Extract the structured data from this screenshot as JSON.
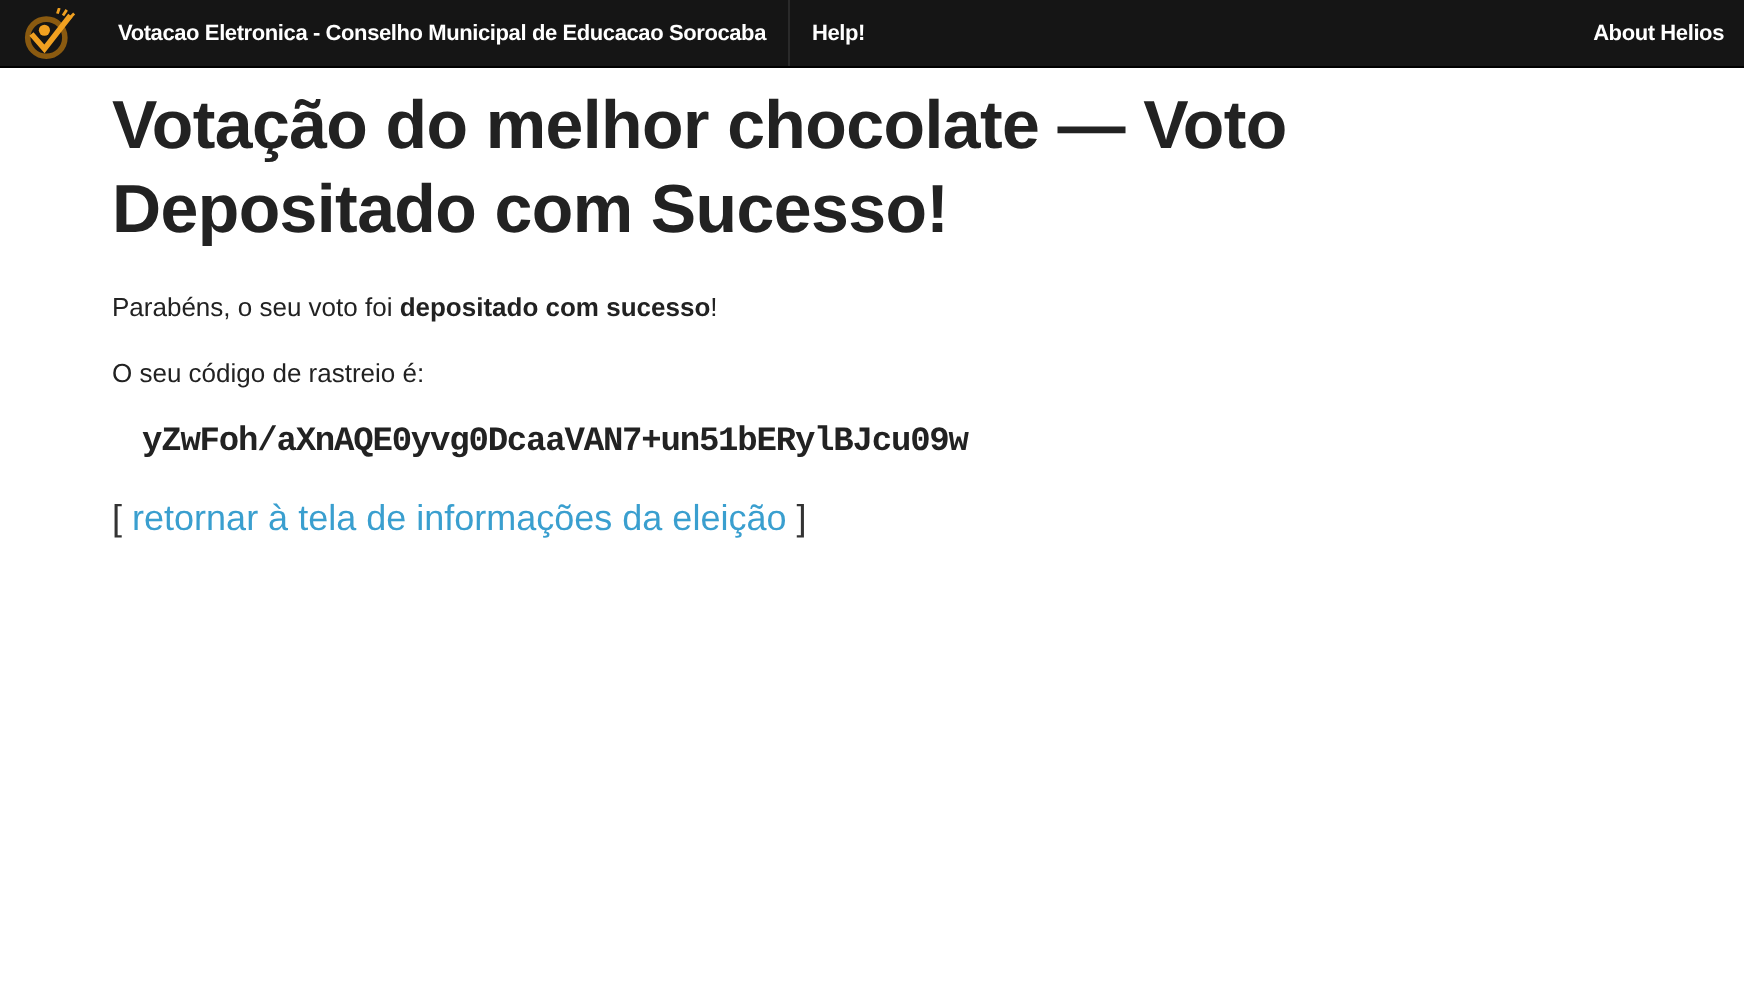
{
  "navbar": {
    "brand": "Votacao Eletronica - Conselho Municipal de Educacao Sorocaba",
    "links": [
      "Help!"
    ],
    "right_links": [
      "About Helios"
    ]
  },
  "heading": "Votação do melhor chocolate — Voto Depositado com Sucesso!",
  "message": "Parabéns, o seu voto foi **depositado com sucesso**!",
  "tracker_label": "O seu código de rastreio é:",
  "tracker_code": "yZwFoh/aXnAQE0yvg0DcaaVAN7+un51bERylBJcu09w",
  "return": {
    "open": "[",
    "link": "retornar à tela de informações da eleição",
    "close": "]"
  }
}
